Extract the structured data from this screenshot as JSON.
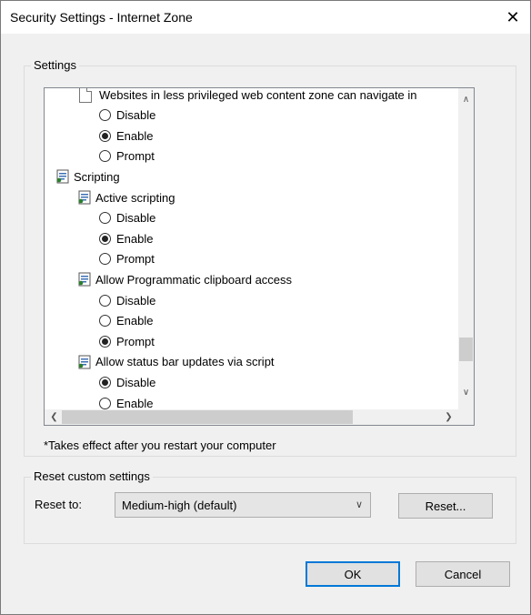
{
  "window": {
    "title": "Security Settings - Internet Zone",
    "close_glyph": "✕"
  },
  "settings": {
    "legend": "Settings",
    "items": [
      {
        "kind": "doc",
        "label": "Websites in less privileged web content zone can navigate in",
        "indent": 1
      },
      {
        "kind": "radio",
        "label": "Disable",
        "checked": false,
        "indent": 2
      },
      {
        "kind": "radio",
        "label": "Enable",
        "checked": true,
        "indent": 2
      },
      {
        "kind": "radio",
        "label": "Prompt",
        "checked": false,
        "indent": 2
      },
      {
        "kind": "script",
        "label": "Scripting",
        "indent": 0
      },
      {
        "kind": "script",
        "label": "Active scripting",
        "indent": 1
      },
      {
        "kind": "radio",
        "label": "Disable",
        "checked": false,
        "indent": 2
      },
      {
        "kind": "radio",
        "label": "Enable",
        "checked": true,
        "indent": 2
      },
      {
        "kind": "radio",
        "label": "Prompt",
        "checked": false,
        "indent": 2
      },
      {
        "kind": "script",
        "label": "Allow Programmatic clipboard access",
        "indent": 1
      },
      {
        "kind": "radio",
        "label": "Disable",
        "checked": false,
        "indent": 2
      },
      {
        "kind": "radio",
        "label": "Enable",
        "checked": false,
        "indent": 2
      },
      {
        "kind": "radio",
        "label": "Prompt",
        "checked": true,
        "indent": 2
      },
      {
        "kind": "script",
        "label": "Allow status bar updates via script",
        "indent": 1
      },
      {
        "kind": "radio",
        "label": "Disable",
        "checked": true,
        "indent": 2
      },
      {
        "kind": "radio",
        "label": "Enable",
        "checked": false,
        "indent": 2
      }
    ],
    "note": "*Takes effect after you restart your computer"
  },
  "reset": {
    "legend": "Reset custom settings",
    "reset_to_label": "Reset to:",
    "selected": "Medium-high (default)",
    "reset_button": "Reset..."
  },
  "footer": {
    "ok": "OK",
    "cancel": "Cancel"
  },
  "icons": {
    "close": "close-icon",
    "scroll_up": "chevron-up-icon",
    "scroll_down": "chevron-down-icon",
    "scroll_left": "chevron-left-icon",
    "scroll_right": "chevron-right-icon",
    "combo_chevron": "chevron-down-icon"
  },
  "colors": {
    "accent": "#0078d7",
    "dialog_bg": "#f0f0f0"
  }
}
